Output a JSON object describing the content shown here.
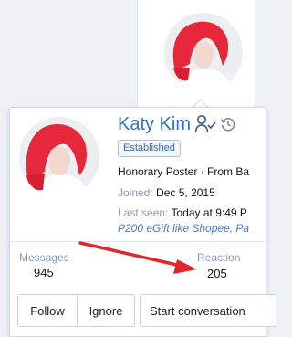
{
  "profile_card": {
    "username": "Katy Kim",
    "badge": "Established",
    "title_line": "Honorary Poster · From Ba",
    "joined_label": "Joined:",
    "joined_value": "Dec 5, 2015",
    "last_seen_label": "Last seen:",
    "last_seen_value": "Today at 9:49 P",
    "gift_text": "P200 eGift like Shopee, Pa",
    "stats": {
      "messages_label": "Messages",
      "messages_value": "945",
      "reaction_label": "Reaction",
      "reaction_value": "205"
    },
    "buttons": {
      "follow": "Follow",
      "ignore": "Ignore",
      "start_conversation": "Start conversation"
    }
  },
  "icons": {
    "follow_status": "user-check-icon",
    "history": "history-icon"
  },
  "colors": {
    "username": "#2f73c6",
    "badge_text": "#3b6ea5",
    "muted_label": "#8c9bb0",
    "annotation_arrow": "#e3242b",
    "page_background": "#eef2f7"
  }
}
